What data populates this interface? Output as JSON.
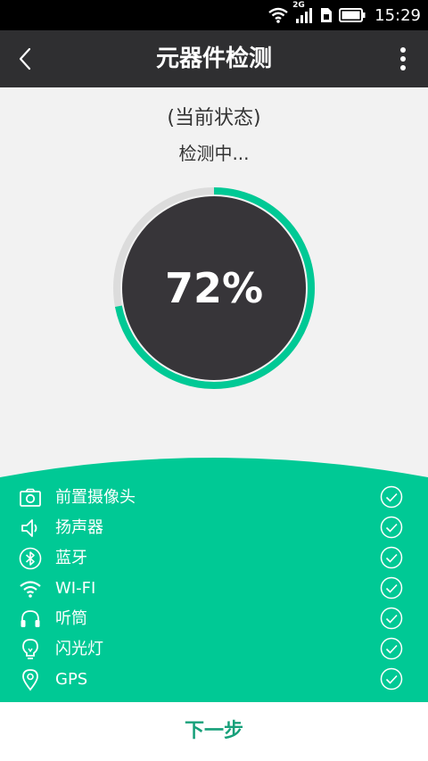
{
  "status_bar": {
    "network": "2G",
    "time": "15:29"
  },
  "app_bar": {
    "title": "元器件检测",
    "back_icon": "chevron-left-icon",
    "menu_icon": "more-vertical-icon"
  },
  "detection": {
    "state_label": "(当前状态)",
    "state_value": "检测中...",
    "progress_percent": 72,
    "progress_text": "72%"
  },
  "colors": {
    "accent": "#00c995",
    "dark": "#2f2f31",
    "ring_track": "#dcdcdc"
  },
  "items": [
    {
      "label": "前置摄像头",
      "icon": "camera-icon",
      "status": "checked"
    },
    {
      "label": "扬声器",
      "icon": "speaker-icon",
      "status": "checked"
    },
    {
      "label": "蓝牙",
      "icon": "bluetooth-icon",
      "status": "checked"
    },
    {
      "label": "WI-FI",
      "icon": "wifi-icon",
      "status": "checked"
    },
    {
      "label": "听筒",
      "icon": "headphones-icon",
      "status": "checked"
    },
    {
      "label": "闪光灯",
      "icon": "bulb-icon",
      "status": "checked"
    },
    {
      "label": "GPS",
      "icon": "location-pin-icon",
      "status": "checked"
    }
  ],
  "footer": {
    "next_label": "下一步"
  }
}
